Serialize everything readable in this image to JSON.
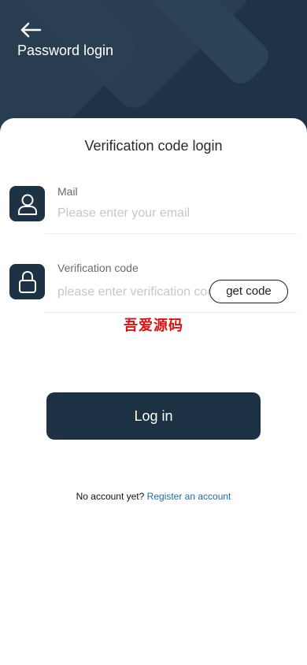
{
  "header": {
    "back_icon": "arrow-left-icon",
    "title": "Password login"
  },
  "card": {
    "title": "Verification code login"
  },
  "mail": {
    "icon": "user-icon",
    "label": "Mail",
    "placeholder": "Please enter your email",
    "value": ""
  },
  "code": {
    "icon": "lock-icon",
    "label": "Verification code",
    "placeholder": "please enter verification code",
    "value": "",
    "get_code_label": "get code"
  },
  "watermark": "吾爱源码",
  "login_button": "Log in",
  "register": {
    "prompt": "No account yet?",
    "link_text": "Register an account"
  },
  "colors": {
    "primary": "#1c3244",
    "link": "#1d6aa8",
    "watermark": "#e01010",
    "background": "#ffffff"
  }
}
